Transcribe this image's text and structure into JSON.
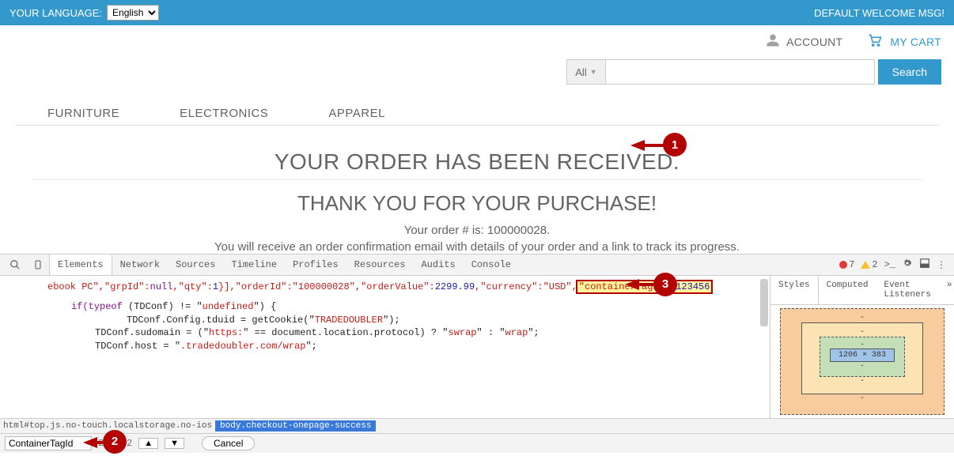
{
  "topbar": {
    "language_label": "YOUR LANGUAGE:",
    "language_value": "English",
    "welcome_msg": "DEFAULT WELCOME MSG!"
  },
  "account_bar": {
    "account_label": "ACCOUNT",
    "cart_label": "MY CART"
  },
  "search": {
    "all_label": "All",
    "search_button": "Search"
  },
  "nav": {
    "items": [
      "FURNITURE",
      "ELECTRONICS",
      "APPAREL"
    ]
  },
  "page": {
    "order_received": "YOUR ORDER HAS BEEN RECEIVED.",
    "thank_you": "THANK YOU FOR YOUR PURCHASE!",
    "order_number_line": "Your order # is: 100000028.",
    "order_info": "You will receive an order confirmation email with details of your order and a link to track its progress."
  },
  "annotations": {
    "a1": "1",
    "a2": "2",
    "a3": "3"
  },
  "devtools": {
    "tabs": [
      "Elements",
      "Network",
      "Sources",
      "Timeline",
      "Profiles",
      "Resources",
      "Audits",
      "Console"
    ],
    "active_tab": "Elements",
    "errors": "7",
    "warnings": "2",
    "code_line1_a": "ebook PC\",\"grpId\":",
    "code_line1_null": "null",
    "code_line1_b": ",\"qty\":",
    "code_line1_qty": "1",
    "code_line1_c": "}],\"orderId\":\"",
    "code_line1_oid": "100000028",
    "code_line1_d": "\",\"orderValue\":",
    "code_line1_val": "2299.99",
    "code_line1_e": ",\"currency\":\"",
    "code_line1_cur": "USD",
    "code_line1_f": "\",",
    "code_hl_key": "\"containerTagId\"",
    "code_hl_colon": ":",
    "code_hl_val": "123456",
    "code_if": "if",
    "code_if_cond": "(typeof",
    "code_if_cond2": " (TDConf) != \"",
    "code_undef": "undefined",
    "code_if_cond3": "\") {",
    "code_l2a": "TDConf.Config.tduid = getCookie(\"",
    "code_l2b": "TRADEDOUBLER",
    "code_l2c": "\");",
    "code_l3a": "TDConf.sudomain = (\"",
    "code_l3b": "https:",
    "code_l3c": "\" == document.location.protocol) ? \"",
    "code_l3d": "swrap",
    "code_l3e": "\" : \"",
    "code_l3f": "wrap",
    "code_l3g": "\";",
    "code_l4a": "TDConf.host = \"",
    "code_l4b": ".tradedoubler.com/wrap",
    "code_l4c": "\";",
    "side_tabs": [
      "Styles",
      "Computed",
      "Event Listeners"
    ],
    "box_dims": "1206 × 383",
    "breadcrumb_plain": "html#top.js.no-touch.localstorage.no-ios",
    "breadcrumb_selected": "body.checkout-onepage-success",
    "find_value": "ContainerTagId",
    "find_count": "2 of 2",
    "cancel": "Cancel"
  }
}
